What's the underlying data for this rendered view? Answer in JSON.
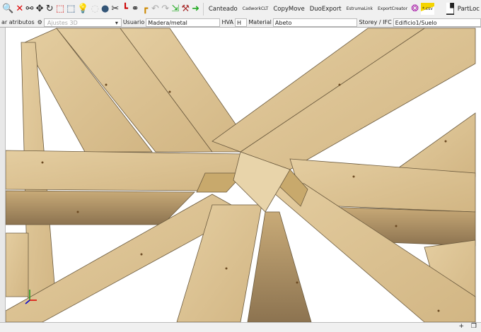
{
  "toolbar": {
    "items": [
      "Canteado",
      "CadworkCLT",
      "CopyMove",
      "DuoExport",
      "EstrumaLink",
      "ExportCreator",
      "PartLoc"
    ],
    "csv_label": "*.csv"
  },
  "attrbar": {
    "attr_label": "ar atributos",
    "preset_placeholder": "Ajustes 3D",
    "user_label": "Usuario",
    "user_value": "Madera/metal",
    "hva_label": "HVA",
    "h_label": "H",
    "material_label": "Material",
    "material_value": "Abeto",
    "storey_label": "Storey / IFC",
    "storey_value": "Edificio1/Suelo"
  },
  "status": {
    "plus": "+",
    "icon": "window-icon"
  },
  "colors": {
    "wood": "#dcc394",
    "wood_dark": "#b89a67",
    "edge": "#6b5a3e"
  }
}
